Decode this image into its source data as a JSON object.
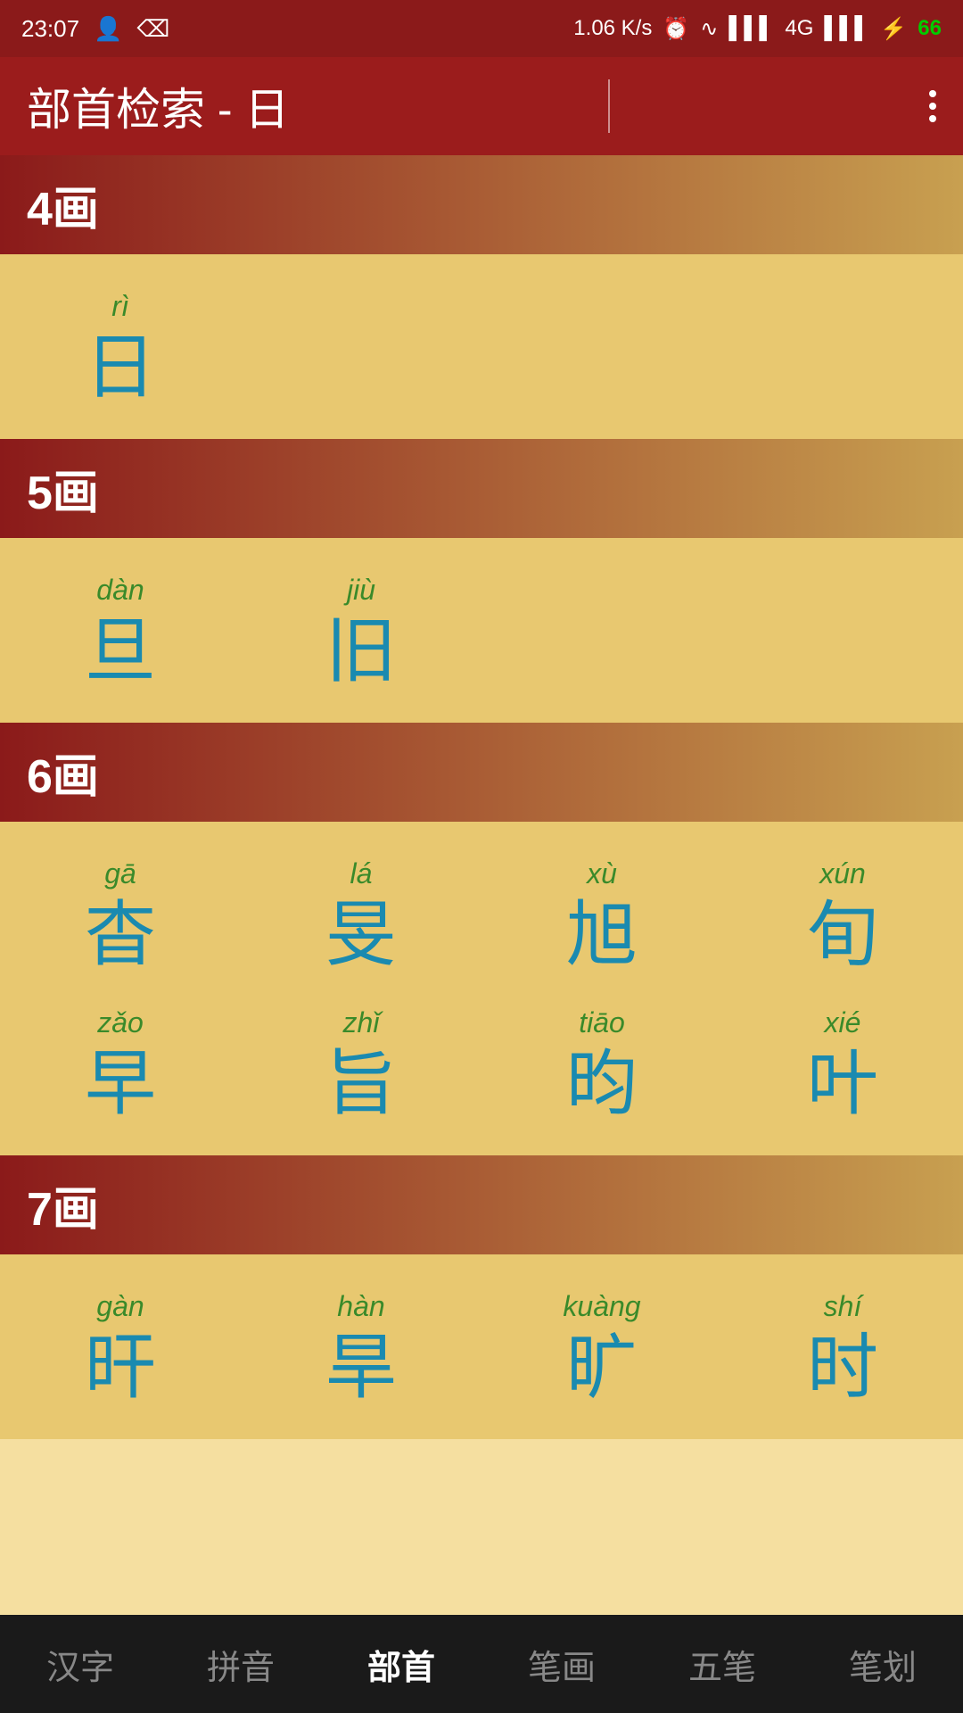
{
  "statusBar": {
    "time": "23:07",
    "speed": "1.06 K/s",
    "battery": "66"
  },
  "appBar": {
    "title": "部首检索 - 日"
  },
  "sections": [
    {
      "id": "4hua",
      "label": "4画",
      "characters": [
        {
          "pinyin": "rì",
          "hanzi": "日"
        }
      ]
    },
    {
      "id": "5hua",
      "label": "5画",
      "characters": [
        {
          "pinyin": "dàn",
          "hanzi": "旦"
        },
        {
          "pinyin": "jiù",
          "hanzi": "旧"
        }
      ]
    },
    {
      "id": "6hua",
      "label": "6画",
      "characters": [
        {
          "pinyin": "gā",
          "hanzi": "杳"
        },
        {
          "pinyin": "lá",
          "hanzi": "旻"
        },
        {
          "pinyin": "xù",
          "hanzi": "旭"
        },
        {
          "pinyin": "xún",
          "hanzi": "旬"
        },
        {
          "pinyin": "zǎo",
          "hanzi": "早"
        },
        {
          "pinyin": "zhǐ",
          "hanzi": "旨"
        },
        {
          "pinyin": "tiāo",
          "hanzi": "昀"
        },
        {
          "pinyin": "xié",
          "hanzi": "叶"
        }
      ]
    },
    {
      "id": "7hua",
      "label": "7画",
      "characters": [
        {
          "pinyin": "gàn",
          "hanzi": "旰"
        },
        {
          "pinyin": "hàn",
          "hanzi": "旱"
        },
        {
          "pinyin": "kuàng",
          "hanzi": "旷"
        },
        {
          "pinyin": "shí",
          "hanzi": "时"
        }
      ]
    }
  ],
  "bottomNav": {
    "items": [
      {
        "label": "汉字",
        "active": false
      },
      {
        "label": "拼音",
        "active": false
      },
      {
        "label": "部首",
        "active": true
      },
      {
        "label": "笔画",
        "active": false
      },
      {
        "label": "五笔",
        "active": false
      },
      {
        "label": "笔划",
        "active": false
      }
    ]
  }
}
